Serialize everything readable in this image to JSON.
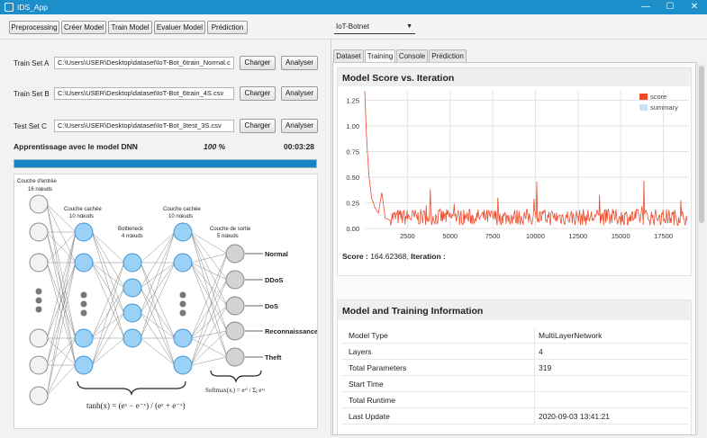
{
  "window": {
    "title": "IDS_App",
    "minimize": "—",
    "maximize": "☐",
    "close": "✕"
  },
  "toolbar": {
    "buttons": [
      "Preprocessing",
      "Créer Model",
      "Train Model",
      "Evaluer Model",
      "Prédiction"
    ],
    "dataset_select": "IoT-Botnet"
  },
  "datasets": {
    "train_a": {
      "label": "Train Set A",
      "path": "C:\\Users\\USER\\Desktop\\dataset\\IoT-Bot_6train_Normal.c"
    },
    "train_b": {
      "label": "Train Set B",
      "path": "C:\\Users\\USER\\Desktop\\dataset\\IoT-Bot_6train_4S.csv"
    },
    "test_c": {
      "label": "Test Set  C",
      "path": "C:\\Users\\USER\\Desktop\\dataset\\IoT-Bot_3test_3S.csv"
    },
    "load_label": "Charger",
    "analyze_label": "Analyser"
  },
  "progress": {
    "label": "Apprentissage avec le model DNN",
    "percent_text": "100 %",
    "time": "00:03:28",
    "value": 1.0
  },
  "diagram": {
    "input_layer": "Couche d'entrée",
    "input_nodes": "16 nœuds",
    "hidden1": "Couche cachée",
    "hidden1_nodes": "10 nœuds",
    "bottleneck": "Bottleneck",
    "bottleneck_nodes": "4 nœuds",
    "hidden2": "Couche cachée",
    "hidden2_nodes": "10 nœuds",
    "output_layer": "Couche de sortie",
    "output_nodes": "5 nœuds",
    "outputs": [
      "Normal",
      "DDoS",
      "DoS",
      "Reconnaissance",
      "Theft"
    ],
    "tanh_formula": "tanh(x) = (eˣ − e⁻ˣ) / (eˣ + e⁻ˣ)",
    "softmax_formula": "Softmax(xᵢ) = eˣⁱ / Σⱼ eˣʲ"
  },
  "tabs": [
    "Dataset",
    "Training",
    "Console",
    "Prédiction"
  ],
  "active_tab": "Training",
  "chart_card": {
    "title": "Model Score vs. Iteration",
    "score_label": "Score :",
    "score_value": "164.62368",
    "iteration_label": "Iteration :"
  },
  "chart_data": {
    "type": "line",
    "title": "Model Score vs. Iteration",
    "xlim": [
      0,
      19000
    ],
    "ylim": [
      0,
      1.35
    ],
    "x_ticks": [
      "2500",
      "5000",
      "7500",
      "10000",
      "12500",
      "15000",
      "17500"
    ],
    "y_ticks": [
      "0.00",
      "0.25",
      "0.50",
      "0.75",
      "1.00",
      "1.25"
    ],
    "legend_position": "top-right",
    "series": [
      {
        "name": "score",
        "color": "#ee4b2b",
        "x": [
          0,
          100,
          250,
          400,
          600,
          800,
          1000,
          1200,
          1500,
          2000,
          2500,
          3000,
          3500,
          4000,
          4500,
          5000,
          5500,
          6000,
          6500,
          7000,
          7500,
          8000,
          8500,
          9000,
          9500,
          10000,
          10500,
          11000,
          11500,
          12000,
          12500,
          13000,
          13500,
          14000,
          14500,
          15000,
          15500,
          16000,
          16500,
          17000,
          17500,
          18000,
          18500,
          18900
        ],
        "y": [
          1.34,
          0.9,
          0.5,
          0.3,
          0.2,
          0.15,
          0.35,
          0.1,
          0.08,
          0.1,
          0.05,
          0.12,
          0.3,
          0.06,
          0.1,
          0.05,
          0.35,
          0.08,
          0.07,
          0.1,
          0.45,
          0.06,
          0.1,
          0.05,
          0.08,
          0.1,
          0.05,
          0.2,
          0.07,
          0.1,
          0.06,
          0.08,
          0.35,
          0.05,
          0.1,
          0.07,
          0.05,
          0.1,
          0.35,
          0.06,
          0.08,
          0.05,
          0.1,
          0.05
        ]
      },
      {
        "name": "summary",
        "color": "#c9e3f6",
        "x": [],
        "y": []
      }
    ]
  },
  "info_card": {
    "title": "Model and Training Information",
    "rows": [
      {
        "key": "Model Type",
        "value": "MultiLayerNetwork"
      },
      {
        "key": "Layers",
        "value": "4"
      },
      {
        "key": "Total Parameters",
        "value": "319"
      },
      {
        "key": "Start Time",
        "value": ""
      },
      {
        "key": "Total Runtime",
        "value": ""
      },
      {
        "key": "Last Update",
        "value": "2020-09-03 13:41:21"
      }
    ]
  }
}
